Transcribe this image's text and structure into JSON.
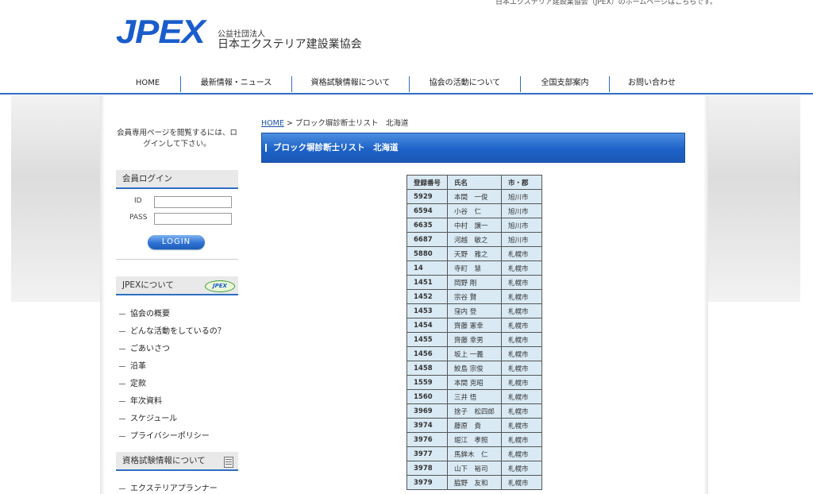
{
  "header": {
    "top_note": "日本エクステリア建設業協会（JPEX）のホームページはこちらです。",
    "logo": "JPEX",
    "org_sub": "公益社団法人",
    "org_name": "日本エクステリア建設業協会"
  },
  "nav": [
    "HOME",
    "最新情報・ニュース",
    "資格試験情報について",
    "協会の活動について",
    "全国支部案内",
    "お問い合わせ"
  ],
  "sidebar": {
    "member_note": "会員専用ページを閲覧するには、ログインして下さい。",
    "login": {
      "title": "会員ログイン",
      "id_label": "ID",
      "pass_label": "PASS",
      "id_value": "",
      "pass_value": "",
      "button": "LOGIN"
    },
    "about": {
      "title": "JPEXについて",
      "badge": "JPEX",
      "items": [
        "協会の概要",
        "どんな活動をしているの？",
        "ごあいさつ",
        "沿革",
        "定款",
        "年次資料",
        "スケジュール",
        "プライバシーポリシー"
      ]
    },
    "exam": {
      "title": "資格試験情報について",
      "items": [
        "エクステリアプランナー"
      ]
    }
  },
  "main": {
    "breadcrumb_home": "HOME",
    "breadcrumb_rest": " > ブロック塀診断士リスト　北海道",
    "title": "ブロック塀診断士リスト　北海道",
    "table": {
      "headers": [
        "登録番号",
        "氏名",
        "市・郡"
      ],
      "rows": [
        [
          "5929",
          "本間　一俊",
          "旭川市"
        ],
        [
          "6594",
          "小谷　仁",
          "旭川市"
        ],
        [
          "6635",
          "中村　譲一",
          "旭川市"
        ],
        [
          "6687",
          "河越　敏之",
          "旭川市"
        ],
        [
          "5880",
          "天野　雅之",
          "札幌市"
        ],
        [
          "14",
          "寺町　慧",
          "札幌市"
        ],
        [
          "1451",
          "岡野 剛",
          "札幌市"
        ],
        [
          "1452",
          "宗谷 賢",
          "札幌市"
        ],
        [
          "1453",
          "窪内 登",
          "札幌市"
        ],
        [
          "1454",
          "齊藤 憲幸",
          "札幌市"
        ],
        [
          "1455",
          "齊藤 幸男",
          "札幌市"
        ],
        [
          "1456",
          "坂上 一義",
          "札幌市"
        ],
        [
          "1458",
          "鮫島 宗俊",
          "札幌市"
        ],
        [
          "1559",
          "本間 克昭",
          "札幌市"
        ],
        [
          "1560",
          "三井 悟",
          "札幌市"
        ],
        [
          "3969",
          "捨子　松四郎",
          "札幌市"
        ],
        [
          "3974",
          "藤原　貴",
          "札幌市"
        ],
        [
          "3976",
          "堀江　孝照",
          "札幌市"
        ],
        [
          "3977",
          "馬鉾木　仁",
          "札幌市"
        ],
        [
          "3978",
          "山下　裕司",
          "札幌市"
        ],
        [
          "3979",
          "脇野　友和",
          "札幌市"
        ]
      ]
    }
  }
}
